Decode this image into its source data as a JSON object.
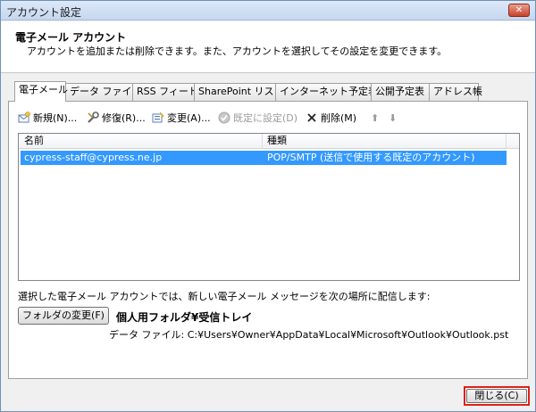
{
  "window": {
    "title": "アカウント設定",
    "close_glyph": "✕"
  },
  "header": {
    "title": "電子メール アカウント",
    "description": "アカウントを追加または削除できます。また、アカウントを選択してその設定を変更できます。"
  },
  "tabs": [
    {
      "label": "電子メール",
      "active": true
    },
    {
      "label": "データ ファイル",
      "active": false
    },
    {
      "label": "RSS フィード",
      "active": false
    },
    {
      "label": "SharePoint リスト",
      "active": false
    },
    {
      "label": "インターネット予定表",
      "active": false
    },
    {
      "label": "公開予定表",
      "active": false
    },
    {
      "label": "アドレス帳",
      "active": false
    }
  ],
  "toolbar": {
    "new_label": "新規(N)...",
    "repair_label": "修復(R)...",
    "change_label": "変更(A)...",
    "default_label": "既定に設定(D)",
    "delete_label": "削除(M)",
    "up_glyph": "⬆",
    "down_glyph": "⬇"
  },
  "list": {
    "columns": [
      "名前",
      "種類"
    ],
    "rows": [
      {
        "name": "cypress-staff@cypress.ne.jp",
        "type": "POP/SMTP (送信で使用する既定のアカウント)",
        "selected": true
      }
    ]
  },
  "delivery": {
    "label": "選択した電子メール アカウントでは、新しい電子メール メッセージを次の場所に配信します:",
    "change_folder_label": "フォルダの変更(F)",
    "folder_name": "個人用フォルダ¥受信トレイ",
    "data_file": "データ ファイル: C:¥Users¥Owner¥AppData¥Local¥Microsoft¥Outlook¥Outlook.pst"
  },
  "footer": {
    "close_label": "閉じる(C)"
  },
  "colors": {
    "selection": "#3399ff",
    "highlight_border": "#e0201a",
    "close_button": "#c8412a"
  }
}
